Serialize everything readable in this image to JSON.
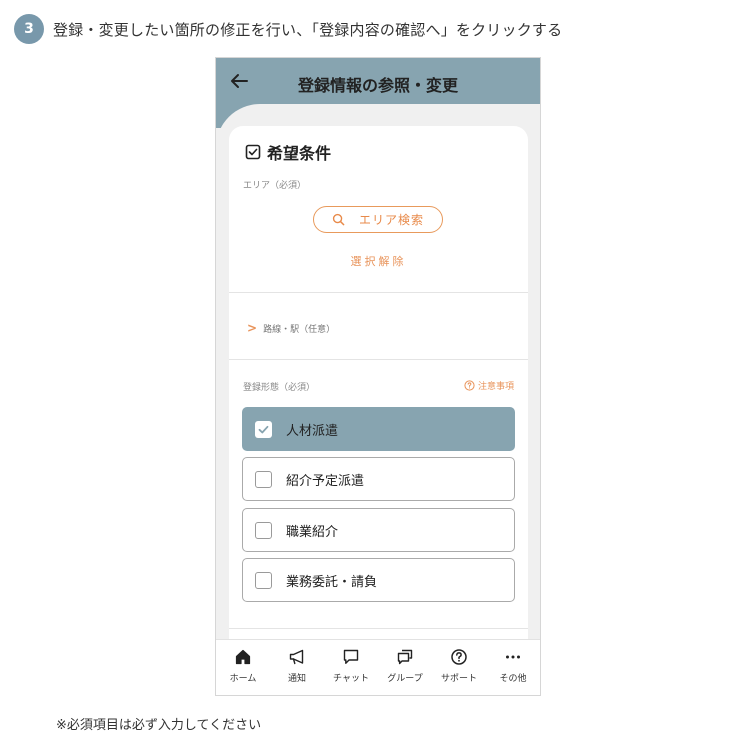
{
  "step": {
    "number": "3",
    "instruction": "登録・変更したい箇所の修正を行い、「登録内容の確認へ」をクリックする"
  },
  "app": {
    "title": "登録情報の参照・変更",
    "back_icon": "arrow-left-icon"
  },
  "preferences": {
    "heading": "希望条件",
    "area_label": "エリア（必須）",
    "area_search_label": "エリア検索",
    "clear_selection_label": "選択解除",
    "route_label": "路線・駅（任意）",
    "employment_type_label": "登録形態（必須）",
    "notes_label": "注意事項",
    "employment_options": [
      {
        "label": "人材派遣",
        "checked": true
      },
      {
        "label": "紹介予定派遣",
        "checked": false
      },
      {
        "label": "職業紹介",
        "checked": false
      },
      {
        "label": "業務委託・請負",
        "checked": false
      }
    ]
  },
  "tabbar": [
    {
      "label": "ホーム",
      "icon": "home-icon"
    },
    {
      "label": "通知",
      "icon": "megaphone-icon"
    },
    {
      "label": "チャット",
      "icon": "chat-icon"
    },
    {
      "label": "グループ",
      "icon": "group-chat-icon"
    },
    {
      "label": "サポート",
      "icon": "help-circle-icon"
    },
    {
      "label": "その他",
      "icon": "more-dots-icon"
    }
  ],
  "footnote": "※必須項目は必ず入力してください",
  "colors": {
    "header": "#87a4b0",
    "accent": "#e8935a",
    "badge": "#7898ab",
    "selected_option": "#87a4b0"
  }
}
